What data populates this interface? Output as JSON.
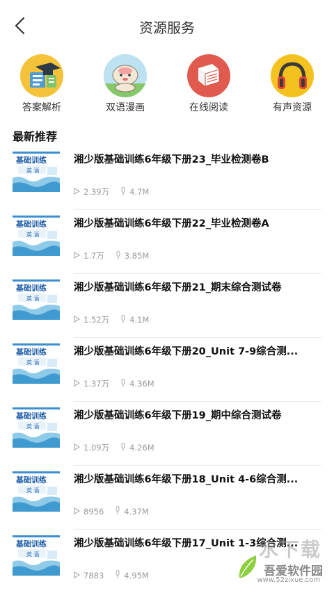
{
  "header": {
    "title": "资源服务",
    "back_icon": "chevron-left-icon"
  },
  "categories": [
    {
      "label": "答案解析",
      "icon": "graduation-cap-icon",
      "color": "#F5C33A"
    },
    {
      "label": "双语漫画",
      "icon": "cartoon-icon",
      "color": "#9ED48C"
    },
    {
      "label": "在线阅读",
      "icon": "book-icon",
      "color": "#E05A4E"
    },
    {
      "label": "有声资源",
      "icon": "headphones-icon",
      "color": "#F3C21E"
    }
  ],
  "section": {
    "title": "最新推荐"
  },
  "items": [
    {
      "title": "湘少版基础训练6年级下册23_毕业检测卷B",
      "plays": "2.39万",
      "size": "4.7M"
    },
    {
      "title": "湘少版基础训练6年级下册22_毕业检测卷A",
      "plays": "1.7万",
      "size": "3.85M"
    },
    {
      "title": "湘少版基础训练6年级下册21_期末综合测试卷",
      "plays": "1.52万",
      "size": "4.1M"
    },
    {
      "title": "湘少版基础训练6年级下册20_Unit 7-9综合测...",
      "plays": "1.37万",
      "size": "4.36M"
    },
    {
      "title": "湘少版基础训练6年级下册19_期中综合测试卷",
      "plays": "1.09万",
      "size": "4.26M"
    },
    {
      "title": "湘少版基础训练6年级下册18_Unit 4-6综合测...",
      "plays": "8956",
      "size": "4.37M"
    },
    {
      "title": "湘少版基础训练6年级下册17_Unit 1-3综合测...",
      "plays": "7883",
      "size": "4.95M"
    }
  ],
  "thumbnail": {
    "title": "基础训练",
    "subject": "英 语"
  },
  "watermark": {
    "big": "水下载",
    "site": "吾爱软件园",
    "url": "www.52zixue.com"
  }
}
